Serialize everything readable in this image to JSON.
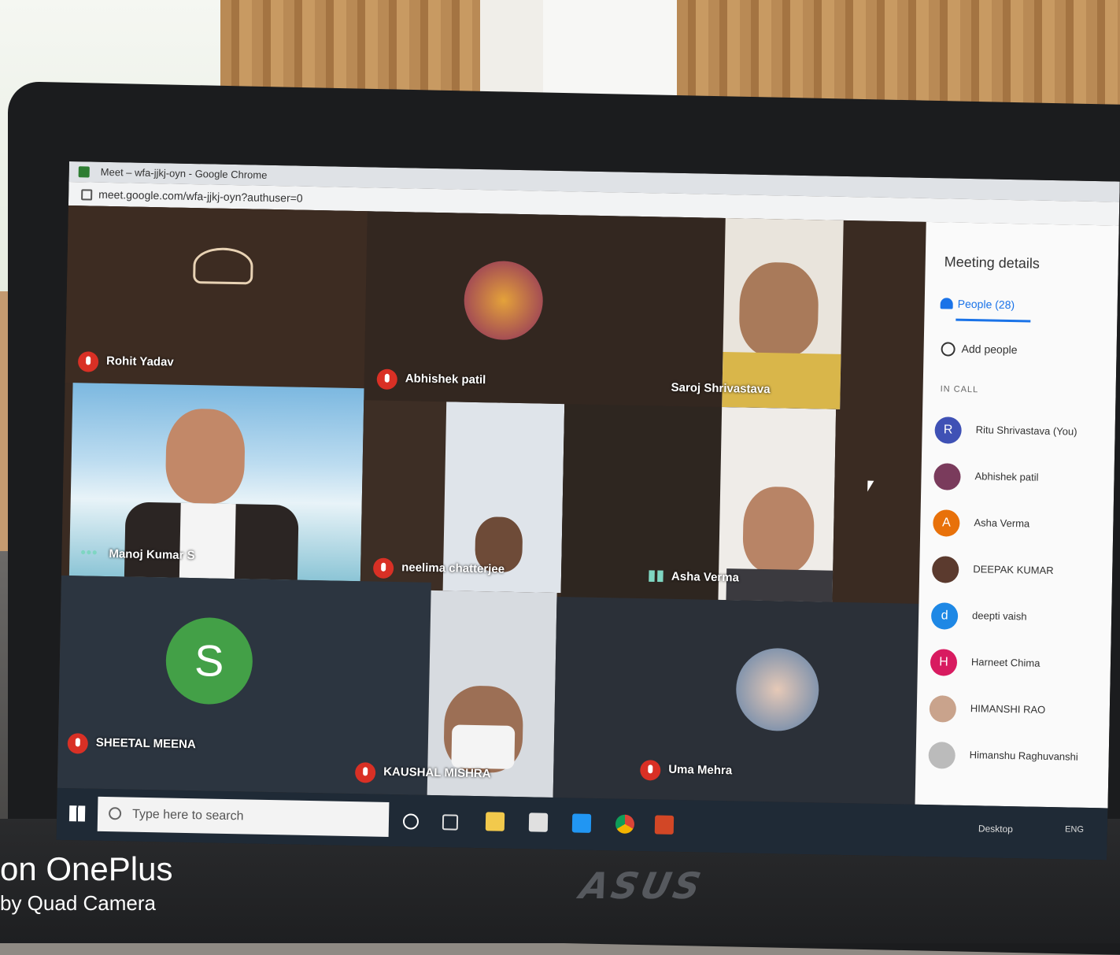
{
  "photo": {
    "watermark_line1": "on OnePlus",
    "watermark_line2": "by Quad Camera",
    "laptop_brand": "ASUS"
  },
  "browser": {
    "window_title": "Meet – wfa-jjkj-oyn - Google Chrome",
    "url": "meet.google.com/wfa-jjkj-oyn?authuser=0"
  },
  "tiles": [
    {
      "name": "Rohit Yadav",
      "muted": true
    },
    {
      "name": "Abhishek patil",
      "muted": true
    },
    {
      "name": "Saroj Shrivastava",
      "muted": false
    },
    {
      "name": "Manoj Kumar S",
      "muted": false
    },
    {
      "name": "neelima chatterjee",
      "muted": true
    },
    {
      "name": "Asha Verma",
      "muted": false
    },
    {
      "name": "SHEETAL MEENA",
      "muted": true,
      "avatar_letter": "S"
    },
    {
      "name": "KAUSHAL MISHRA",
      "muted": true
    },
    {
      "name": "Uma Mehra",
      "muted": true
    }
  ],
  "panel": {
    "title": "Meeting details",
    "people_tab": "People (28)",
    "add_people": "Add people",
    "in_call_label": "IN CALL",
    "participants": [
      {
        "letter": "R",
        "name": "Ritu Shrivastava (You)",
        "color": "#3f51b5"
      },
      {
        "letter": "",
        "name": "Abhishek patil",
        "color": "#7a3b5c"
      },
      {
        "letter": "A",
        "name": "Asha Verma",
        "color": "#e8710a"
      },
      {
        "letter": "",
        "name": "DEEPAK KUMAR",
        "color": "#5b3a2e"
      },
      {
        "letter": "d",
        "name": "deepti vaish",
        "color": "#1e88e5"
      },
      {
        "letter": "H",
        "name": "Harneet Chima",
        "color": "#d81b60"
      },
      {
        "letter": "",
        "name": "HIMANSHI RAO",
        "color": "#c9a38c"
      },
      {
        "letter": "",
        "name": "Himanshu Raghuvanshi",
        "color": "#bbbbbb"
      }
    ]
  },
  "taskbar": {
    "search_placeholder": "Type here to search",
    "desktop_label": "Desktop",
    "lang": "ENG"
  }
}
